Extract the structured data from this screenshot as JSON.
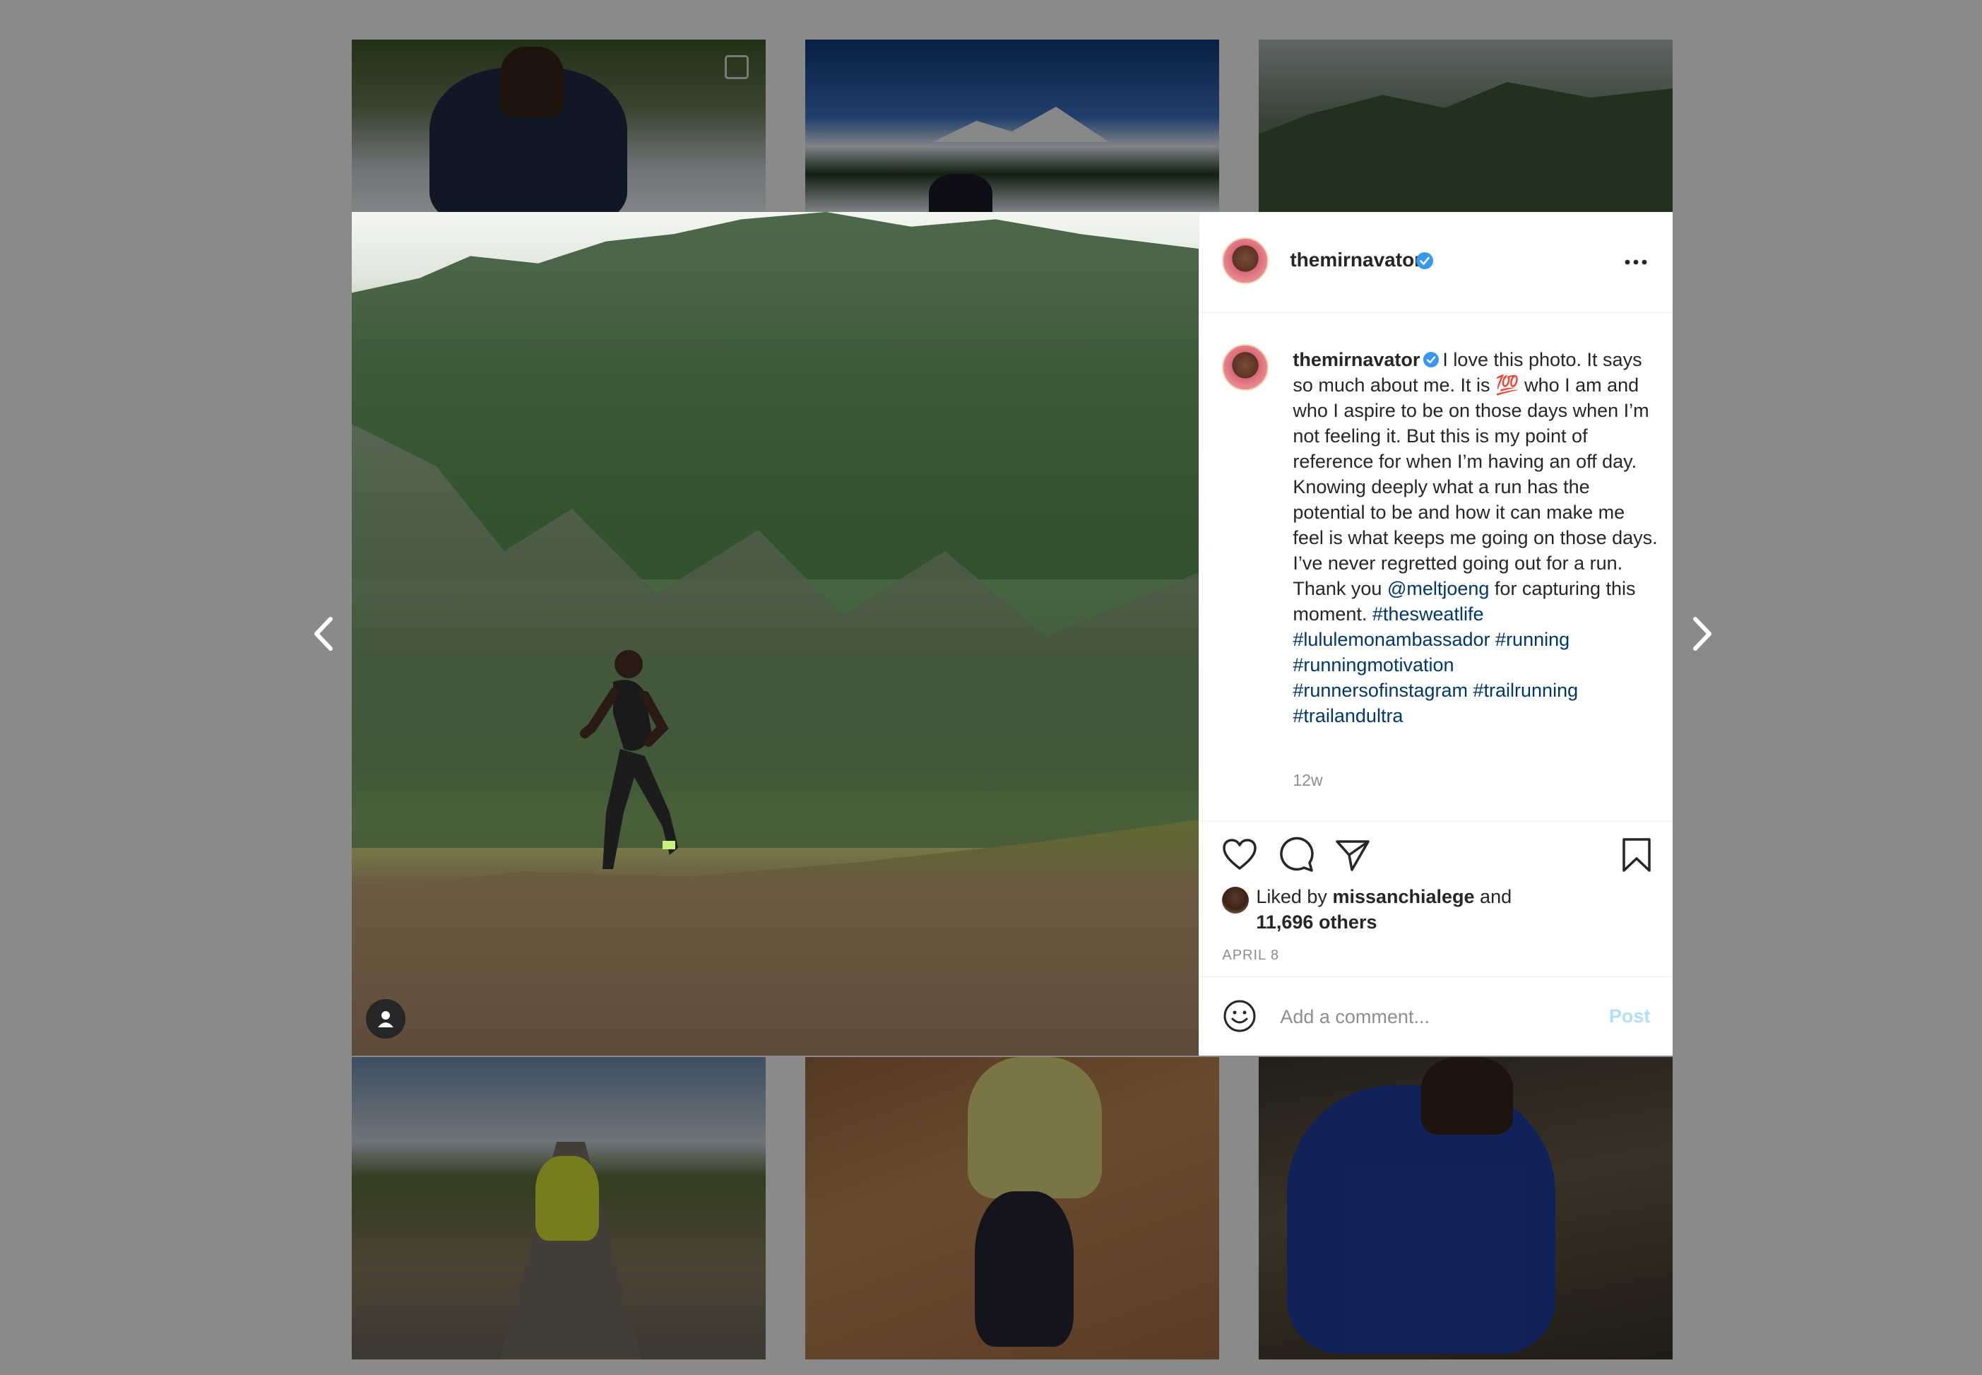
{
  "post": {
    "username": "themirnavator",
    "caption": {
      "text_1": "I love this photo. It says so much about me. It is ",
      "emoji": "💯",
      "text_2": " who I am and who I aspire to be on those days when I’m not feeling it. But this is my point of reference for when I’m having an off day. Knowing deeply what a run has the potential to be and how it can make me feel is what keeps me going on those days. I’ve never regretted going out for a run.",
      "thanks_prefix": "Thank you ",
      "mention": "@meltjoeng",
      "thanks_suffix": " for capturing this moment. ",
      "hashtags": [
        "#thesweatlife",
        "#lululemonambassador",
        "#running",
        "#runningmotivation",
        "#runnersofinstagram",
        "#trailrunning",
        "#trailandultra"
      ]
    },
    "time_ago": "12w",
    "likes": {
      "prefix": "Liked by ",
      "liker": "missanchialege",
      "middle": " and ",
      "others": "11,696 others"
    },
    "date": "APRIL 8",
    "comment": {
      "placeholder": "Add a comment...",
      "post_label": "Post"
    }
  },
  "icons": {
    "prev": "chevron-left-icon",
    "next": "chevron-right-icon",
    "more": "more-options-icon",
    "verified": "verified-badge-icon",
    "like": "heart-icon",
    "comment": "comment-icon",
    "share": "share-icon",
    "save": "bookmark-icon",
    "emoji": "emoji-icon",
    "tagged": "user-tag-icon"
  },
  "colors": {
    "verified": "#3897f0",
    "link": "#00376b",
    "post_disabled": "#b2dffc",
    "muted": "#8e8e8e",
    "overlay": "#8a8a8a"
  }
}
